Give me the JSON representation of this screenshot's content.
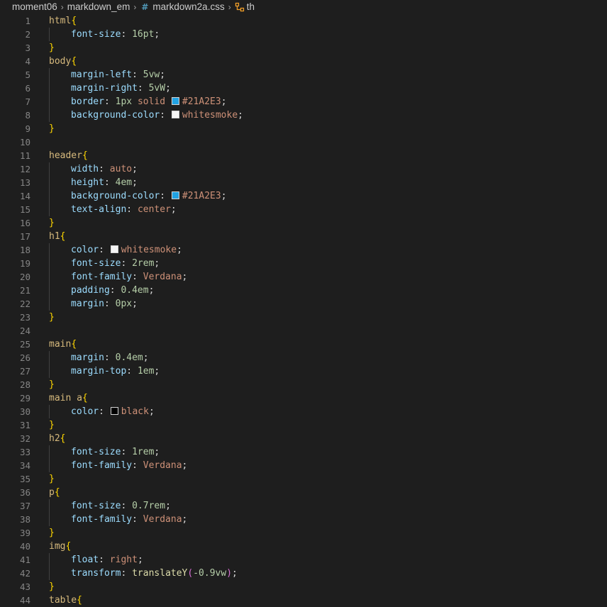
{
  "breadcrumb": {
    "items": [
      "moment06",
      "markdown_em",
      "markdown2a.css",
      "th"
    ]
  },
  "colors": {
    "background": "#1e1e1e",
    "line_number": "#858585",
    "selector": "#d7ba7d",
    "brace": "#ffd700",
    "paren": "#da70d6",
    "property": "#9cdcfe",
    "number": "#b5cea8",
    "string_value": "#ce9178",
    "function": "#dcdcaa",
    "file_icon": "#519aba",
    "symbol_icon": "#ee9d28"
  },
  "icons": {
    "file_icon": "css-file-icon",
    "symbol_icon": "symbol-structure-icon",
    "separator": "chevron-right-icon"
  },
  "code_lines": [
    {
      "n": "1",
      "indent": 0,
      "tokens": [
        {
          "t": "html",
          "c": "sel"
        },
        {
          "t": "{",
          "c": "brace"
        }
      ]
    },
    {
      "n": "2",
      "indent": 1,
      "tokens": [
        {
          "t": "font-size",
          "c": "prop"
        },
        {
          "t": ": ",
          "c": "punc"
        },
        {
          "t": "16pt",
          "c": "num"
        },
        {
          "t": ";",
          "c": "punc"
        }
      ]
    },
    {
      "n": "3",
      "indent": 0,
      "tokens": [
        {
          "t": "}",
          "c": "brace"
        }
      ]
    },
    {
      "n": "4",
      "indent": 0,
      "tokens": [
        {
          "t": "body",
          "c": "sel"
        },
        {
          "t": "{",
          "c": "brace"
        }
      ]
    },
    {
      "n": "5",
      "indent": 1,
      "tokens": [
        {
          "t": "margin-left",
          "c": "prop"
        },
        {
          "t": ": ",
          "c": "punc"
        },
        {
          "t": "5vw",
          "c": "num"
        },
        {
          "t": ";",
          "c": "punc"
        }
      ]
    },
    {
      "n": "6",
      "indent": 1,
      "tokens": [
        {
          "t": "margin-right",
          "c": "prop"
        },
        {
          "t": ": ",
          "c": "punc"
        },
        {
          "t": "5vW",
          "c": "num"
        },
        {
          "t": ";",
          "c": "punc"
        }
      ]
    },
    {
      "n": "7",
      "indent": 1,
      "tokens": [
        {
          "t": "border",
          "c": "prop"
        },
        {
          "t": ": ",
          "c": "punc"
        },
        {
          "t": "1px",
          "c": "num"
        },
        {
          "t": " ",
          "c": "punc"
        },
        {
          "t": "solid",
          "c": "val"
        },
        {
          "t": " ",
          "c": "punc"
        },
        {
          "swatch": "#21A2E3"
        },
        {
          "t": "#21A2E3",
          "c": "val"
        },
        {
          "t": ";",
          "c": "punc"
        }
      ]
    },
    {
      "n": "8",
      "indent": 1,
      "tokens": [
        {
          "t": "background-color",
          "c": "prop"
        },
        {
          "t": ": ",
          "c": "punc"
        },
        {
          "swatch": "#f5f5f5"
        },
        {
          "t": "whitesmoke",
          "c": "val"
        },
        {
          "t": ";",
          "c": "punc"
        }
      ]
    },
    {
      "n": "9",
      "indent": 0,
      "tokens": [
        {
          "t": "}",
          "c": "brace"
        }
      ]
    },
    {
      "n": "10",
      "indent": 0,
      "tokens": []
    },
    {
      "n": "11",
      "indent": 0,
      "tokens": [
        {
          "t": "header",
          "c": "sel"
        },
        {
          "t": "{",
          "c": "brace"
        }
      ]
    },
    {
      "n": "12",
      "indent": 1,
      "tokens": [
        {
          "t": "width",
          "c": "prop"
        },
        {
          "t": ": ",
          "c": "punc"
        },
        {
          "t": "auto",
          "c": "val"
        },
        {
          "t": ";",
          "c": "punc"
        }
      ]
    },
    {
      "n": "13",
      "indent": 1,
      "tokens": [
        {
          "t": "height",
          "c": "prop"
        },
        {
          "t": ": ",
          "c": "punc"
        },
        {
          "t": "4em",
          "c": "num"
        },
        {
          "t": ";",
          "c": "punc"
        }
      ]
    },
    {
      "n": "14",
      "indent": 1,
      "tokens": [
        {
          "t": "background-color",
          "c": "prop"
        },
        {
          "t": ": ",
          "c": "punc"
        },
        {
          "swatch": "#21A2E3"
        },
        {
          "t": "#21A2E3",
          "c": "val"
        },
        {
          "t": ";",
          "c": "punc"
        }
      ]
    },
    {
      "n": "15",
      "indent": 1,
      "tokens": [
        {
          "t": "text-align",
          "c": "prop"
        },
        {
          "t": ": ",
          "c": "punc"
        },
        {
          "t": "center",
          "c": "val"
        },
        {
          "t": ";",
          "c": "punc"
        }
      ]
    },
    {
      "n": "16",
      "indent": 0,
      "tokens": [
        {
          "t": "}",
          "c": "brace"
        }
      ]
    },
    {
      "n": "17",
      "indent": 0,
      "tokens": [
        {
          "t": "h1",
          "c": "sel"
        },
        {
          "t": "{",
          "c": "brace"
        }
      ]
    },
    {
      "n": "18",
      "indent": 1,
      "tokens": [
        {
          "t": "color",
          "c": "prop"
        },
        {
          "t": ": ",
          "c": "punc"
        },
        {
          "swatch": "#f5f5f5"
        },
        {
          "t": "whitesmoke",
          "c": "val"
        },
        {
          "t": ";",
          "c": "punc"
        }
      ]
    },
    {
      "n": "19",
      "indent": 1,
      "tokens": [
        {
          "t": "font-size",
          "c": "prop"
        },
        {
          "t": ": ",
          "c": "punc"
        },
        {
          "t": "2rem",
          "c": "num"
        },
        {
          "t": ";",
          "c": "punc"
        }
      ]
    },
    {
      "n": "20",
      "indent": 1,
      "tokens": [
        {
          "t": "font-family",
          "c": "prop"
        },
        {
          "t": ": ",
          "c": "punc"
        },
        {
          "t": "Verdana",
          "c": "val"
        },
        {
          "t": ";",
          "c": "punc"
        }
      ]
    },
    {
      "n": "21",
      "indent": 1,
      "tokens": [
        {
          "t": "padding",
          "c": "prop"
        },
        {
          "t": ": ",
          "c": "punc"
        },
        {
          "t": "0.4em",
          "c": "num"
        },
        {
          "t": ";",
          "c": "punc"
        }
      ]
    },
    {
      "n": "22",
      "indent": 1,
      "tokens": [
        {
          "t": "margin",
          "c": "prop"
        },
        {
          "t": ": ",
          "c": "punc"
        },
        {
          "t": "0px",
          "c": "num"
        },
        {
          "t": ";",
          "c": "punc"
        }
      ]
    },
    {
      "n": "23",
      "indent": 0,
      "tokens": [
        {
          "t": "}",
          "c": "brace"
        }
      ]
    },
    {
      "n": "24",
      "indent": 0,
      "tokens": []
    },
    {
      "n": "25",
      "indent": 0,
      "tokens": [
        {
          "t": "main",
          "c": "sel"
        },
        {
          "t": "{",
          "c": "brace"
        }
      ]
    },
    {
      "n": "26",
      "indent": 1,
      "tokens": [
        {
          "t": "margin",
          "c": "prop"
        },
        {
          "t": ": ",
          "c": "punc"
        },
        {
          "t": "0.4em",
          "c": "num"
        },
        {
          "t": ";",
          "c": "punc"
        }
      ]
    },
    {
      "n": "27",
      "indent": 1,
      "tokens": [
        {
          "t": "margin-top",
          "c": "prop"
        },
        {
          "t": ": ",
          "c": "punc"
        },
        {
          "t": "1em",
          "c": "num"
        },
        {
          "t": ";",
          "c": "punc"
        }
      ]
    },
    {
      "n": "28",
      "indent": 0,
      "tokens": [
        {
          "t": "}",
          "c": "brace"
        }
      ]
    },
    {
      "n": "29",
      "indent": 0,
      "tokens": [
        {
          "t": "main a",
          "c": "sel"
        },
        {
          "t": "{",
          "c": "brace"
        }
      ]
    },
    {
      "n": "30",
      "indent": 1,
      "tokens": [
        {
          "t": "color",
          "c": "prop"
        },
        {
          "t": ": ",
          "c": "punc"
        },
        {
          "swatch": "#000000"
        },
        {
          "t": "black",
          "c": "val"
        },
        {
          "t": ";",
          "c": "punc"
        }
      ]
    },
    {
      "n": "31",
      "indent": 0,
      "tokens": [
        {
          "t": "}",
          "c": "brace"
        }
      ]
    },
    {
      "n": "32",
      "indent": 0,
      "tokens": [
        {
          "t": "h2",
          "c": "sel"
        },
        {
          "t": "{",
          "c": "brace"
        }
      ]
    },
    {
      "n": "33",
      "indent": 1,
      "tokens": [
        {
          "t": "font-size",
          "c": "prop"
        },
        {
          "t": ": ",
          "c": "punc"
        },
        {
          "t": "1rem",
          "c": "num"
        },
        {
          "t": ";",
          "c": "punc"
        }
      ]
    },
    {
      "n": "34",
      "indent": 1,
      "tokens": [
        {
          "t": "font-family",
          "c": "prop"
        },
        {
          "t": ": ",
          "c": "punc"
        },
        {
          "t": "Verdana",
          "c": "val"
        },
        {
          "t": ";",
          "c": "punc"
        }
      ]
    },
    {
      "n": "35",
      "indent": 0,
      "tokens": [
        {
          "t": "}",
          "c": "brace"
        }
      ]
    },
    {
      "n": "36",
      "indent": 0,
      "tokens": [
        {
          "t": "p",
          "c": "sel"
        },
        {
          "t": "{",
          "c": "brace"
        }
      ]
    },
    {
      "n": "37",
      "indent": 1,
      "tokens": [
        {
          "t": "font-size",
          "c": "prop"
        },
        {
          "t": ": ",
          "c": "punc"
        },
        {
          "t": "0.7rem",
          "c": "num"
        },
        {
          "t": ";",
          "c": "punc"
        }
      ]
    },
    {
      "n": "38",
      "indent": 1,
      "tokens": [
        {
          "t": "font-family",
          "c": "prop"
        },
        {
          "t": ": ",
          "c": "punc"
        },
        {
          "t": "Verdana",
          "c": "val"
        },
        {
          "t": ";",
          "c": "punc"
        }
      ]
    },
    {
      "n": "39",
      "indent": 0,
      "tokens": [
        {
          "t": "}",
          "c": "brace"
        }
      ]
    },
    {
      "n": "40",
      "indent": 0,
      "tokens": [
        {
          "t": "img",
          "c": "sel"
        },
        {
          "t": "{",
          "c": "brace"
        }
      ]
    },
    {
      "n": "41",
      "indent": 1,
      "tokens": [
        {
          "t": "float",
          "c": "prop"
        },
        {
          "t": ": ",
          "c": "punc"
        },
        {
          "t": "right",
          "c": "val"
        },
        {
          "t": ";",
          "c": "punc"
        }
      ]
    },
    {
      "n": "42",
      "indent": 1,
      "tokens": [
        {
          "t": "transform",
          "c": "prop"
        },
        {
          "t": ": ",
          "c": "punc"
        },
        {
          "t": "translateY",
          "c": "fn"
        },
        {
          "t": "(",
          "c": "paren"
        },
        {
          "t": "-0.9vw",
          "c": "num"
        },
        {
          "t": ")",
          "c": "paren"
        },
        {
          "t": ";",
          "c": "punc"
        }
      ]
    },
    {
      "n": "43",
      "indent": 0,
      "tokens": [
        {
          "t": "}",
          "c": "brace"
        }
      ]
    },
    {
      "n": "44",
      "indent": 0,
      "tokens": [
        {
          "t": "table",
          "c": "sel"
        },
        {
          "t": "{",
          "c": "brace"
        }
      ]
    }
  ]
}
